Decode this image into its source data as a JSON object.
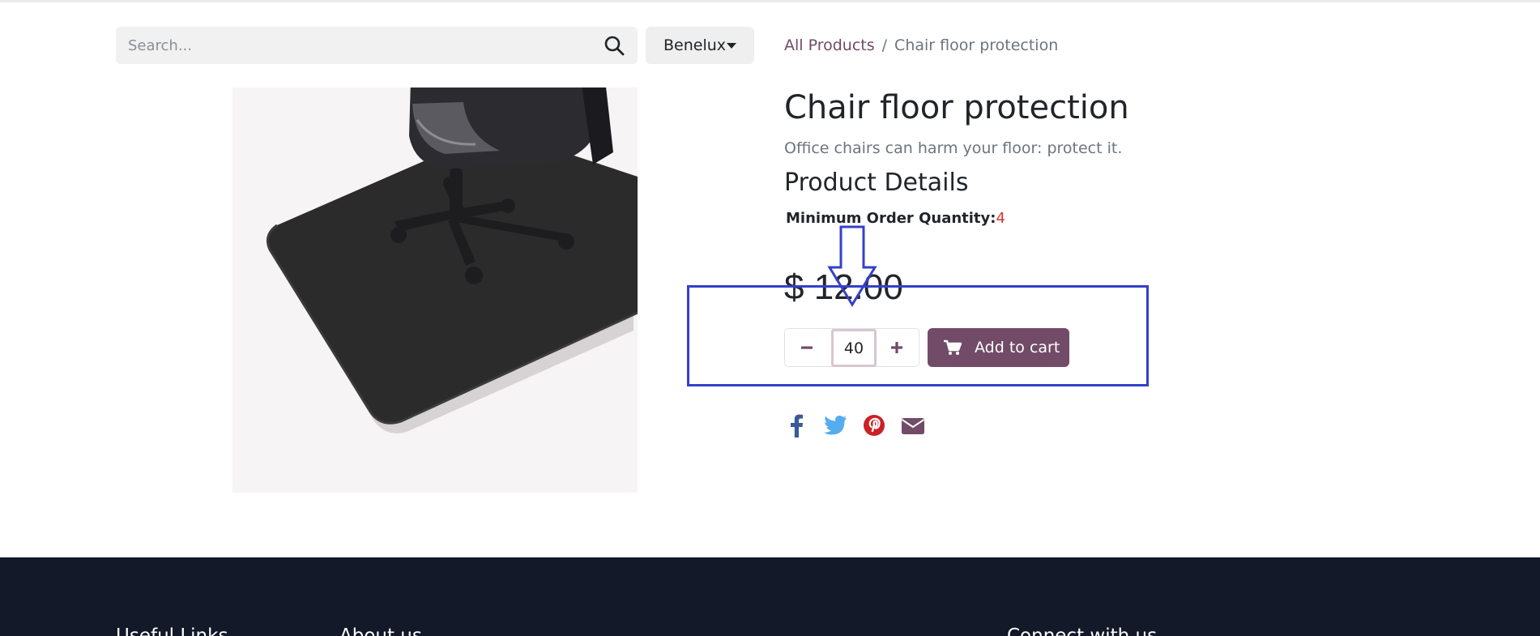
{
  "search": {
    "placeholder": "Search..."
  },
  "pricelist": {
    "label": "Benelux"
  },
  "breadcrumb": {
    "all_products": "All Products",
    "separator": "/",
    "current": "Chair floor protection"
  },
  "product": {
    "title": "Chair floor protection",
    "description": "Office chairs can harm your floor: protect it.",
    "details_heading": "Product Details",
    "min_order_label": "Minimum Order Quantity:",
    "min_order_value": "4",
    "price": "$ 12.00",
    "quantity": "40",
    "add_to_cart_label": "Add to cart",
    "image_icon": "chair-mat-image"
  },
  "social": {
    "icons": [
      "facebook-icon",
      "twitter-icon",
      "pinterest-icon",
      "email-icon"
    ]
  },
  "footer": {
    "col1": "Useful Links",
    "col2": "About us",
    "col3": "Connect with us"
  },
  "colors": {
    "accent": "#714b67",
    "annotation": "#3540c8",
    "footer_bg": "#141929",
    "min_order_value": "#e03131"
  }
}
